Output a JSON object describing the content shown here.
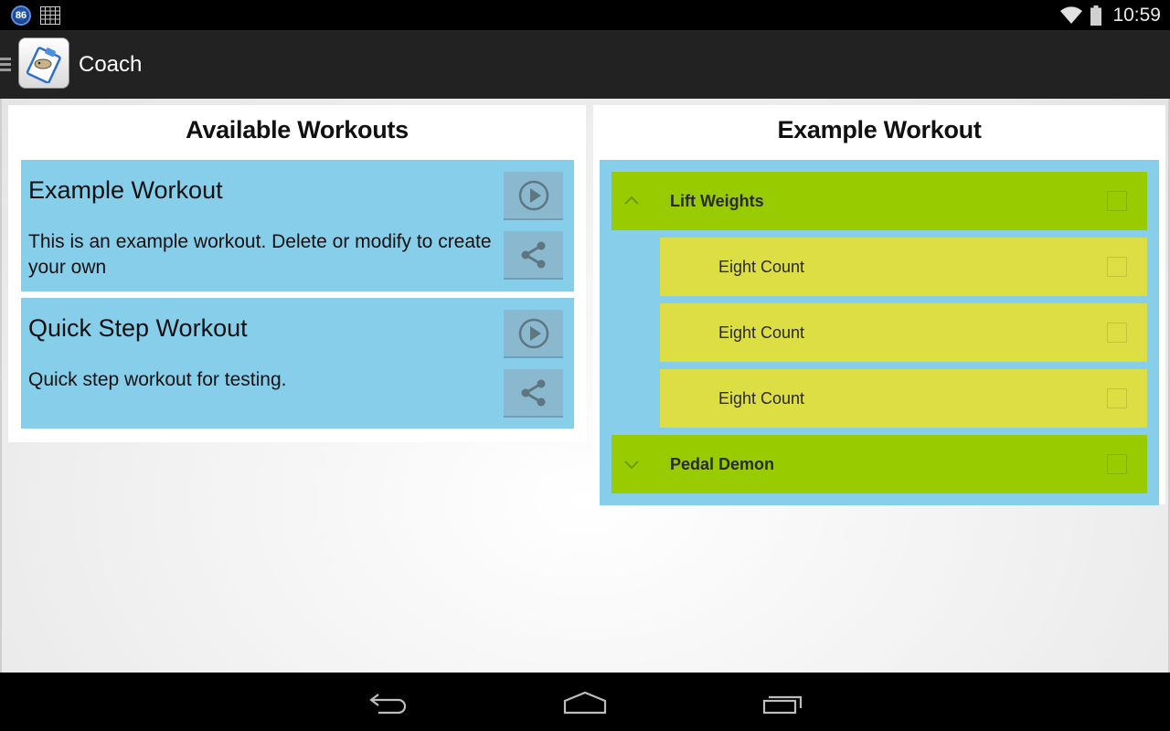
{
  "status_bar": {
    "notification_badge": "86",
    "notification_icons": [
      "badge-86-icon",
      "calendar-grid-icon"
    ],
    "system_icons": [
      "wifi-icon",
      "battery-icon"
    ],
    "time": "10:59"
  },
  "action_bar": {
    "menu_icon": "hamburger-icon",
    "app_icon": "clipboard-coach-icon",
    "title": "Coach"
  },
  "available_workouts": {
    "title": "Available Workouts",
    "items": [
      {
        "name": "Example Workout",
        "description": "This is an example workout. Delete or modify to create your own",
        "actions": [
          "play",
          "share"
        ]
      },
      {
        "name": "Quick Step Workout",
        "description": "Quick step workout for testing.",
        "actions": [
          "play",
          "share"
        ]
      }
    ]
  },
  "workout_detail": {
    "title": "Example Workout",
    "groups": [
      {
        "label": "Lift Weights",
        "expanded": true,
        "checked": false,
        "children": [
          {
            "label": "Eight Count",
            "checked": false
          },
          {
            "label": "Eight Count",
            "checked": false
          },
          {
            "label": "Eight Count",
            "checked": false
          }
        ]
      },
      {
        "label": "Pedal Demon",
        "expanded": false,
        "checked": false,
        "children": []
      }
    ]
  },
  "nav_bar": {
    "buttons": [
      "back",
      "home",
      "recents"
    ]
  },
  "colors": {
    "card_blue": "#87ceeb",
    "group_green": "#99cc00",
    "child_yellow": "#dddd44",
    "action_bar": "#222222"
  }
}
